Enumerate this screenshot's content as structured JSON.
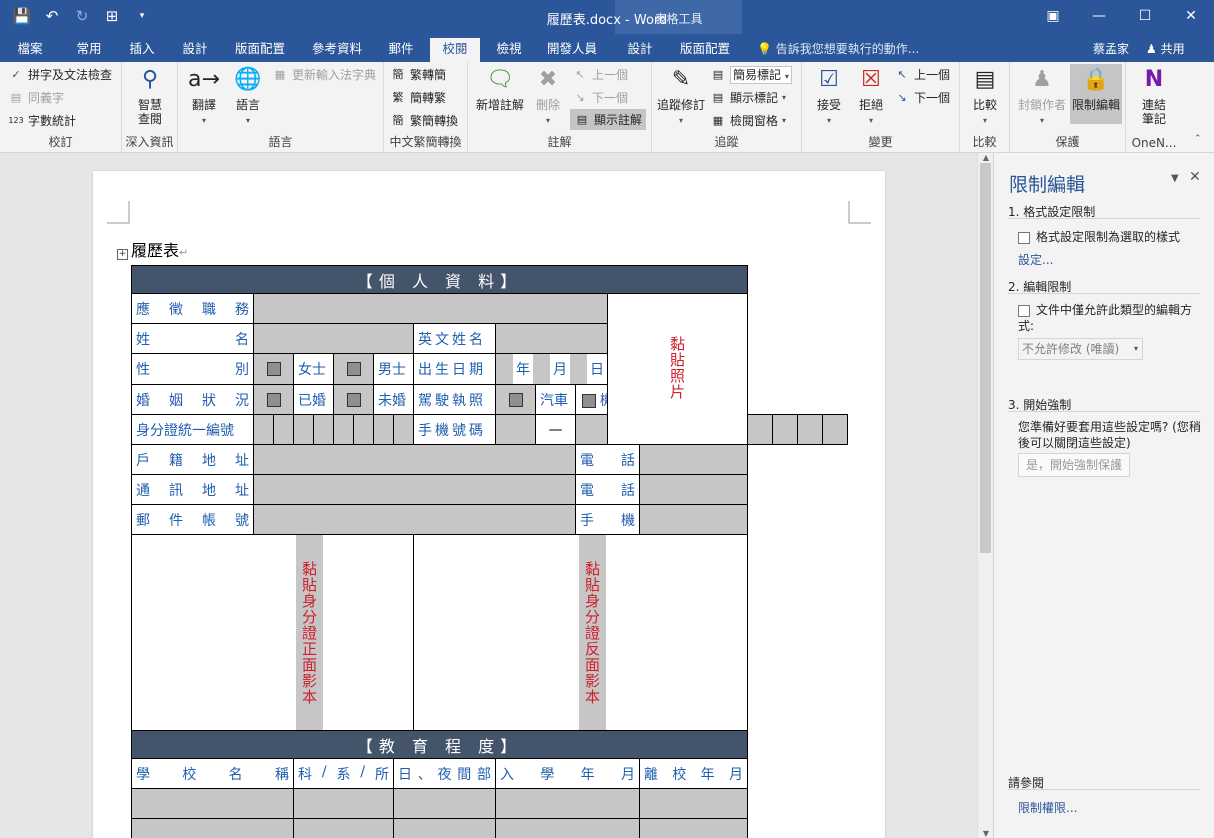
{
  "window": {
    "title": "履歷表.docx - Word",
    "context_tab": "表格工具"
  },
  "tabs": [
    {
      "label": "檔案"
    },
    {
      "label": "常用"
    },
    {
      "label": "插入"
    },
    {
      "label": "設計"
    },
    {
      "label": "版面配置"
    },
    {
      "label": "參考資料"
    },
    {
      "label": "郵件"
    },
    {
      "label": "校閱"
    },
    {
      "label": "檢視"
    },
    {
      "label": "開發人員"
    },
    {
      "label": "設計"
    },
    {
      "label": "版面配置"
    }
  ],
  "active_tab": "校閱",
  "tell_me": "告訴我您想要執行的動作...",
  "user": "蔡孟家",
  "share": "共用",
  "ribbon": {
    "proofing": {
      "label": "校訂",
      "spelling": "拼字及文法檢查",
      "thesaurus": "同義字",
      "wordcount": "字數統計"
    },
    "insights": {
      "label": "深入資訊",
      "smart": "智慧查閱"
    },
    "language": {
      "label": "語言",
      "translate": "翻譯",
      "lang": "語言",
      "ime": "更新輸入法字典"
    },
    "chinese": {
      "label": "中文繁簡轉換",
      "t2s": "繁轉簡",
      "s2t": "簡轉繁",
      "conv": "繁簡轉換"
    },
    "comments": {
      "label": "註解",
      "new": "新增註解",
      "delete": "刪除",
      "prev": "上一個",
      "next": "下一個",
      "show": "顯示註解"
    },
    "tracking": {
      "label": "追蹤",
      "track": "追蹤修訂",
      "markup": "簡易標記",
      "showmarkup": "顯示標記",
      "pane": "檢閱窗格"
    },
    "changes": {
      "label": "變更",
      "accept": "接受",
      "reject": "拒絕",
      "prev": "上一個",
      "next": "下一個"
    },
    "compare": {
      "label": "比較",
      "compare": "比較"
    },
    "protect": {
      "label": "保護",
      "block": "封鎖作者",
      "restrict": "限制編輯"
    },
    "onenote": {
      "label": "OneN...",
      "linked": "連結筆記"
    }
  },
  "document": {
    "title": "履歷表",
    "sec_personal": "【個 人 資 料】",
    "lbl_position": "應 徵 職 務",
    "lbl_name": "姓 名",
    "lbl_english": "英文姓名",
    "lbl_gender": "性 別",
    "opt_female": "女士",
    "opt_male": "男士",
    "lbl_birth": "出生日期",
    "year": "年",
    "month": "月",
    "day": "日",
    "lbl_marital": "婚 姻 狀 況",
    "opt_married": "已婚",
    "opt_single": "未婚",
    "lbl_license": "駕駛執照",
    "opt_car": "汽車",
    "opt_moto": "機車",
    "lbl_id": "身分證統一編號",
    "lbl_mobile": "手機號碼",
    "dash": "—",
    "lbl_household": "戶 籍 地 址",
    "lbl_phone": "電 話",
    "lbl_mail": "通 訊 地 址",
    "lbl_bank": "郵 件 帳 號",
    "lbl_hand": "手 機",
    "photo": "黏貼照片",
    "id_front": "黏貼身分證正面影本",
    "id_back": "黏貼身分證反面影本",
    "sec_edu": "【教 育 程 度】",
    "edu_cols": [
      "學 校 名 稱",
      "科 / 系 / 所",
      "日 、 夜 間 部",
      "入 學 年 月",
      "離 校 年 月"
    ]
  },
  "pane": {
    "title": "限制編輯",
    "s1_title": "1. 格式設定限制",
    "s1_check": "格式設定限制為選取的樣式",
    "s1_link": "設定...",
    "s2_title": "2. 編輯限制",
    "s2_check": "文件中僅允許此類型的編輯方式:",
    "s2_select": "不允許修改 (唯讀)",
    "s3_title": "3. 開始強制",
    "s3_text": "您準備好要套用這些設定嗎? (您稍後可以關閉這些設定)",
    "s3_btn": "是，開始強制保護",
    "see_also": "請參閱",
    "perm_link": "限制權限..."
  },
  "colors": {
    "accent": "#2b579a",
    "header_bar": "#44546a",
    "label_blue": "#1f5faf",
    "red": "#d01f2b"
  }
}
